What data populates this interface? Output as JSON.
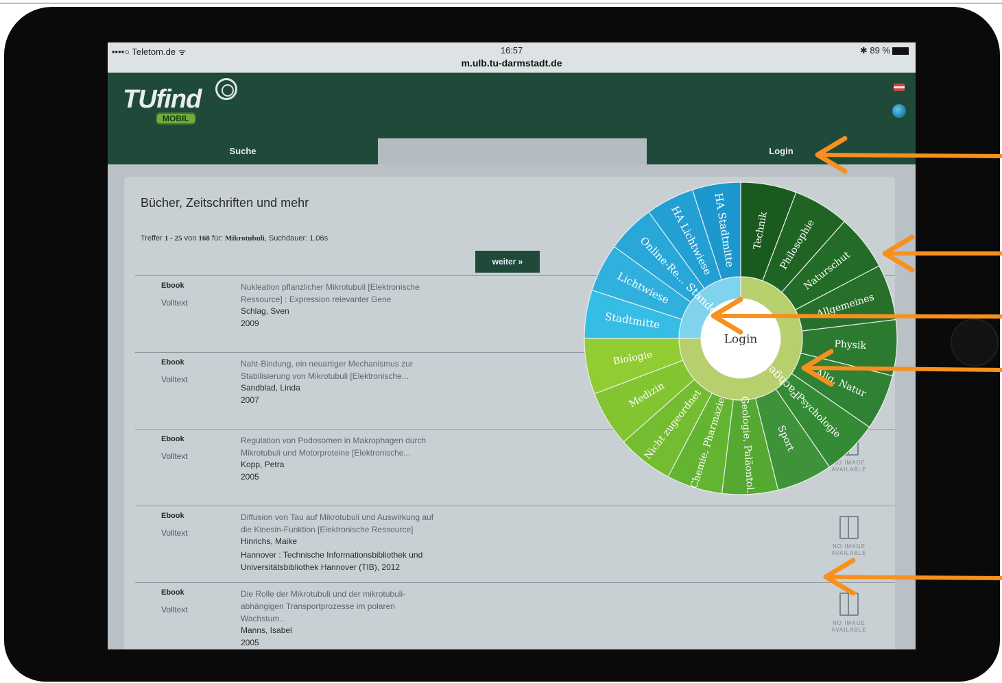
{
  "status": {
    "carrier": "••••○ Teletom.de ᯤ",
    "time": "16:57",
    "url": "m.ulb.tu-darmstadt.de",
    "battery": "✱ 89 %"
  },
  "header": {
    "logo_text": "TUfind",
    "logo_sub": "MOBIL"
  },
  "tabs": {
    "suche": "Suche",
    "login": "Login"
  },
  "main": {
    "title": "Bücher, Zeitschriften und mehr",
    "hits_prefix": "Treffer",
    "hits_range": "1 - 25",
    "hits_von": "von",
    "hits_total": "168",
    "hits_fuer": "für:",
    "hits_query": "Mikrotubuli",
    "hits_duration": ", Suchdauer: 1.06s",
    "weiter_label": "weiter »"
  },
  "results": [
    {
      "type": "Ebook",
      "link": "Volltext",
      "title_lines": [
        "Nukleation pflanzlicher Mikrotubuli [Elektronische",
        "Ressource] : Expression relevanter Gene"
      ],
      "author": "Schlag, Sven",
      "extra": [],
      "year": "2009"
    },
    {
      "type": "Ebook",
      "link": "Volltext",
      "title_lines": [
        "Naht-Bindung, ein neuartiger Mechanismus zur",
        "Stabilisierung von Mikrotubuli [Elektronische..."
      ],
      "author": "Sandblad, Linda",
      "extra": [],
      "year": "2007"
    },
    {
      "type": "Ebook",
      "link": "Volltext",
      "title_lines": [
        "Regulation von Podosomen in Makrophagen durch",
        "Mikrotubuli und Motorproteine [Elektronische..."
      ],
      "author": "Kopp, Petra",
      "extra": [],
      "year": "2005"
    },
    {
      "type": "Ebook",
      "link": "Volltext",
      "title_lines": [
        "Diffusion von Tau auf Mikrotubuli und Auswirkung auf",
        "die Kinesin-Funktion [Elektronische Ressource]"
      ],
      "author": "Hinrichs, Maike",
      "extra": [
        "Hannover : Technische Informationsbibliothek und",
        "Universitätsbibliothek Hannover (TIB), 2012"
      ],
      "year": ""
    },
    {
      "type": "Ebook",
      "link": "Volltext",
      "title_lines": [
        "Die Rolle der Mikrotubuli und der mikrotubuli-",
        "abhängigen Transportprozesse im polaren",
        "Wachstum..."
      ],
      "author": "Manns, Isabel",
      "extra": [],
      "year": "2005"
    }
  ],
  "noimage": {
    "line1": "NO IMAGE",
    "line2": "AVAILABLE"
  },
  "wheel": {
    "center_label": "Login",
    "standort_label": "Standort",
    "fachgebiet_label": "Fachgebiet",
    "standort_items": [
      "Stadtmitte",
      "Lichtwiese",
      "Online-Re...",
      "HA Lichtwiese",
      "HA Stadtmitte"
    ],
    "fach_items": [
      "Technik",
      "Philosophie",
      "Naturschut",
      "Allgemeines",
      "Physik",
      "Allg. Natur",
      "Psychologie",
      "Sport",
      "Geologie, Paläontol...",
      "Chemie, Pharmazie",
      "Nicht zugeordnet",
      "Medizin",
      "Biologie"
    ],
    "colors": {
      "standort_outer": [
        "#36bde6",
        "#2fb0dd",
        "#28a7d8",
        "#22a0d4",
        "#1d98cf"
      ],
      "fach_dark": [
        "#1b5a1f",
        "#1f6423",
        "#236c27",
        "#276f2b",
        "#2b7a2f",
        "#2f8133",
        "#358a36",
        "#3d923a",
        "#55a830",
        "#63b430",
        "#74bc30",
        "#83c530",
        "#92cc33"
      ],
      "inner_standort": "#7fd3ec",
      "inner_fach": "#b8cf6d",
      "hub": "#ffffff"
    }
  },
  "annotation": {
    "arrow_color": "#f7901e"
  }
}
